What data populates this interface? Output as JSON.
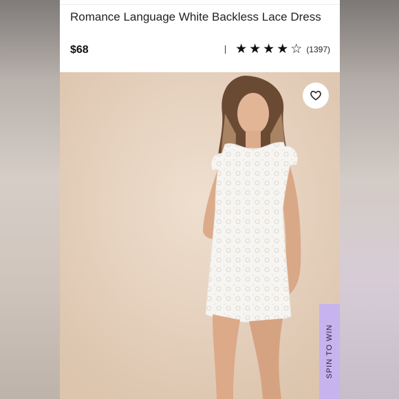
{
  "product": {
    "title": "Romance Language White Backless Lace Dress",
    "price": "$68",
    "rating": {
      "value": 4,
      "max": 5,
      "count_label": "(1397)"
    }
  },
  "image": {
    "icon": "heart-icon"
  },
  "promo": {
    "spin_label": "SPIN TO WIN",
    "color": "#c7b3ee"
  },
  "colors": {
    "price": "#111111",
    "background": "#e6d2bd"
  }
}
